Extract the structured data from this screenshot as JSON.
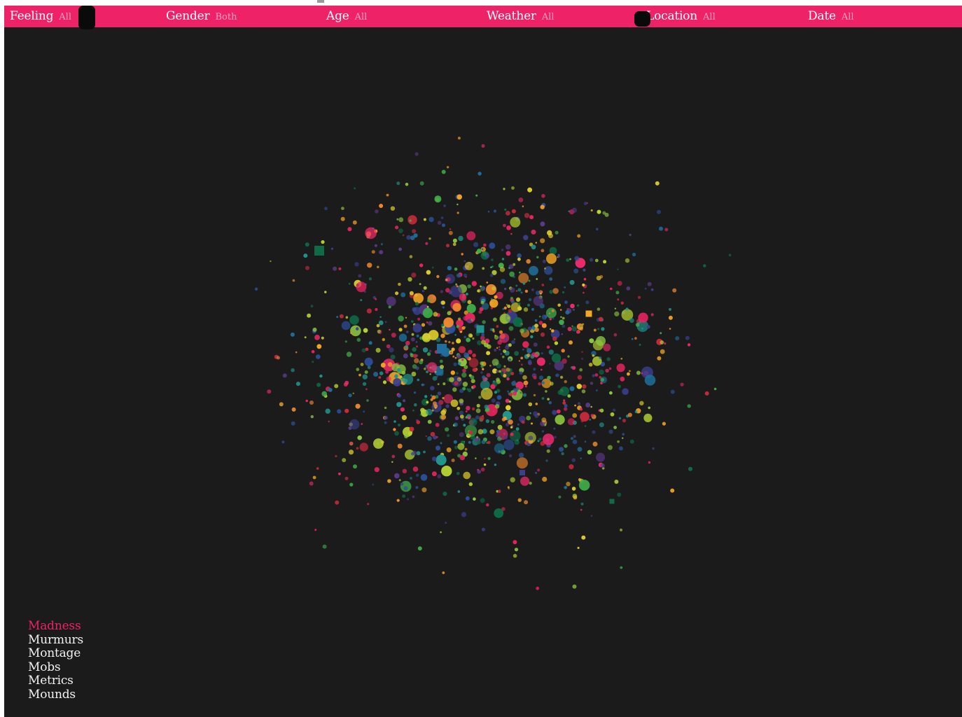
{
  "filters": [
    {
      "label": "Feeling",
      "value": "All"
    },
    {
      "label": "Gender",
      "value": "Both"
    },
    {
      "label": "Age",
      "value": "All"
    },
    {
      "label": "Weather",
      "value": "All"
    },
    {
      "label": "Location",
      "value": "All"
    },
    {
      "label": "Date",
      "value": "All"
    }
  ],
  "views": [
    {
      "label": "Madness",
      "active": true
    },
    {
      "label": "Murmurs",
      "active": false
    },
    {
      "label": "Montage",
      "active": false
    },
    {
      "label": "Mobs",
      "active": false
    },
    {
      "label": "Metrics",
      "active": false
    },
    {
      "label": "Mounds",
      "active": false
    }
  ],
  "colors": {
    "accent": "#ee2266",
    "background": "#1b1b1b",
    "palette": [
      "#e8245f",
      "#ee2a6b",
      "#f28a2e",
      "#f5a623",
      "#e0cf2c",
      "#b7d333",
      "#8cc63f",
      "#3fae49",
      "#21948c",
      "#1f6e9b",
      "#2c4f9a",
      "#3a3f8c",
      "#5a3a86",
      "#cc2a3c",
      "#0e6b46"
    ]
  }
}
